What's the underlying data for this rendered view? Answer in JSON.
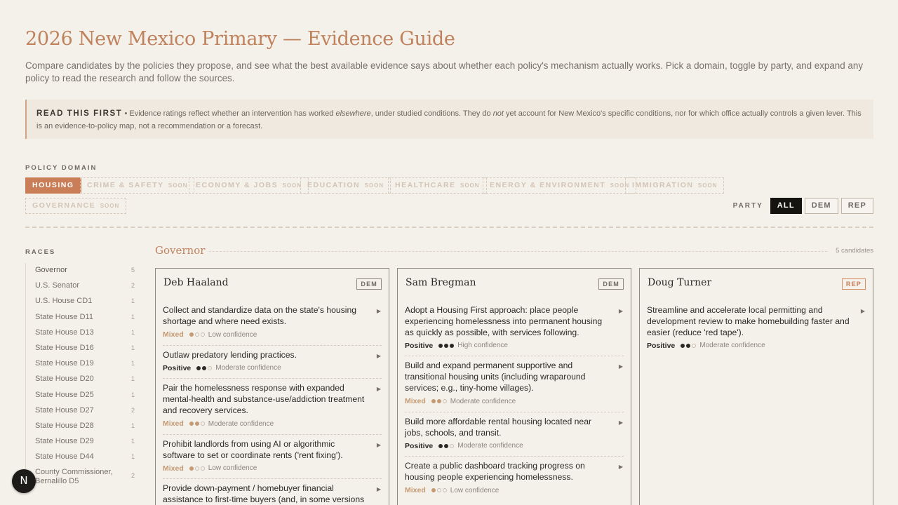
{
  "header": {
    "title": "2026 New Mexico Primary — Evidence Guide",
    "subtitle": "Compare candidates by the policies they propose, and see what the best available evidence says about whether each policy's mechanism actually works. Pick a domain, toggle by party, and expand any policy to read the research and follow the sources."
  },
  "notice": {
    "lead": "READ THIS FIRST",
    "sep": " • ",
    "t1": "Evidence ratings reflect whether an intervention has worked ",
    "em1": "elsewhere",
    "t2": ", under studied conditions. They do ",
    "em2": "not",
    "t3": " yet account for New Mexico's specific conditions, nor for which office actually controls a given lever. This is an evidence-to-policy map, not a recommendation or a forecast."
  },
  "domain_label": "POLICY DOMAIN",
  "soon": "SOON",
  "domains": [
    {
      "label": "HOUSING"
    },
    {
      "label": "CRIME & SAFETY"
    },
    {
      "label": "ECONOMY & JOBS"
    },
    {
      "label": "EDUCATION"
    },
    {
      "label": "HEALTHCARE"
    },
    {
      "label": "ENERGY & ENVIRONMENT"
    },
    {
      "label": "IMMIGRATION"
    },
    {
      "label": "GOVERNANCE"
    }
  ],
  "party": {
    "label": "PARTY",
    "options": [
      "ALL",
      "DEM",
      "REP"
    ]
  },
  "races_label": "RACES",
  "races": [
    {
      "name": "Governor",
      "count": "5"
    },
    {
      "name": "U.S. Senator",
      "count": "2"
    },
    {
      "name": "U.S. House CD1",
      "count": "1"
    },
    {
      "name": "State House D11",
      "count": "1"
    },
    {
      "name": "State House D13",
      "count": "1"
    },
    {
      "name": "State House D16",
      "count": "1"
    },
    {
      "name": "State House D19",
      "count": "1"
    },
    {
      "name": "State House D20",
      "count": "1"
    },
    {
      "name": "State House D25",
      "count": "1"
    },
    {
      "name": "State House D27",
      "count": "2"
    },
    {
      "name": "State House D28",
      "count": "1"
    },
    {
      "name": "State House D29",
      "count": "1"
    },
    {
      "name": "State House D44",
      "count": "1"
    },
    {
      "name": "County Commissioner, Bernalillo D5",
      "count": "2"
    }
  ],
  "race_view": {
    "name": "Governor",
    "count_label": "5 candidates"
  },
  "candidates": [
    {
      "name": "Deb Haaland",
      "party": "DEM",
      "policies": [
        {
          "text": "Collect and standardize data on the state's housing shortage and where need exists.",
          "rating": "Mixed",
          "confidence": "Low confidence"
        },
        {
          "text": "Outlaw predatory lending practices.",
          "rating": "Positive",
          "confidence": "Moderate confidence"
        },
        {
          "text": "Pair the homelessness response with expanded mental-health and substance-use/addiction treatment and recovery services.",
          "rating": "Mixed",
          "confidence": "Moderate confidence"
        },
        {
          "text": "Prohibit landlords from using AI or algorithmic software to set or coordinate rents ('rent fixing').",
          "rating": "Mixed",
          "confidence": "Low confidence"
        },
        {
          "text": "Provide down-payment / homebuyer financial assistance to first-time buyers (and, in some versions",
          "rating": "",
          "confidence": ""
        }
      ]
    },
    {
      "name": "Sam Bregman",
      "party": "DEM",
      "policies": [
        {
          "text": "Adopt a Housing First approach: place people experiencing homelessness into permanent housing as quickly as possible, with services following.",
          "rating": "Positive",
          "confidence": "High confidence"
        },
        {
          "text": "Build and expand permanent supportive and transitional housing units (including wraparound services; e.g., tiny-home villages).",
          "rating": "Mixed",
          "confidence": "Moderate confidence"
        },
        {
          "text": "Build more affordable rental housing located near jobs, schools, and transit.",
          "rating": "Positive",
          "confidence": "Moderate confidence"
        },
        {
          "text": "Create a public dashboard tracking progress on housing people experiencing homelessness.",
          "rating": "Mixed",
          "confidence": "Low confidence"
        }
      ]
    },
    {
      "name": "Doug Turner",
      "party": "REP",
      "policies": [
        {
          "text": "Streamline and accelerate local permitting and development review to make homebuilding faster and easier (reduce 'red tape').",
          "rating": "Positive",
          "confidence": "Moderate confidence"
        }
      ]
    }
  ],
  "fab": {
    "label": "N"
  }
}
